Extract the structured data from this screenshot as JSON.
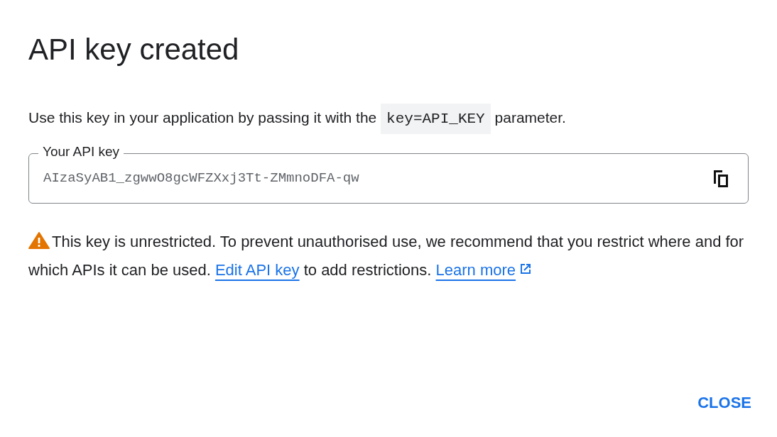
{
  "dialog": {
    "title": "API key created",
    "description": [
      {
        "kind": "text",
        "text": "Use this key in your application by passing it with the "
      },
      {
        "kind": "code",
        "text": "key=API_KEY"
      },
      {
        "kind": "text",
        "text": " parameter."
      }
    ],
    "key_field": {
      "label": "Your API key",
      "value": "AIzaSyAB1_zgwwO8gcWFZXxj3Tt-ZMmnoDFA-qw"
    },
    "warning": [
      {
        "kind": "text",
        "text": "This key is unrestricted. To prevent unauthorised use, we recommend that you restrict where and for which APIs it can be used. "
      },
      {
        "kind": "link",
        "text": "Edit API key",
        "external": false
      },
      {
        "kind": "text",
        "text": " to add restrictions. "
      },
      {
        "kind": "link",
        "text": "Learn more",
        "external": true
      }
    ],
    "buttons": [
      "CLOSE"
    ]
  }
}
